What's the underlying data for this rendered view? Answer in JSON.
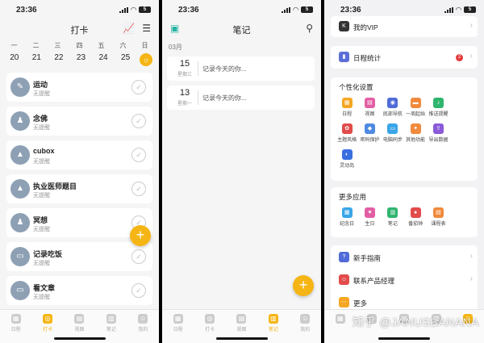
{
  "status": {
    "time": "23:36",
    "battery": "5"
  },
  "checkin": {
    "title": "打卡",
    "weekdays": [
      "日",
      "一",
      "二",
      "三",
      "四",
      "五",
      "六",
      "日"
    ],
    "dates": [
      "20",
      "21",
      "22",
      "23",
      "24",
      "25",
      "26"
    ],
    "items": [
      {
        "name": "运动",
        "sub": "无提醒"
      },
      {
        "name": "念佛",
        "sub": "无提醒"
      },
      {
        "name": "cubox",
        "sub": "无提醒"
      },
      {
        "name": "执业医师题目",
        "sub": "无提醒"
      },
      {
        "name": "冥想",
        "sub": "无提醒"
      },
      {
        "name": "记录吃饭",
        "sub": "无提醒"
      },
      {
        "name": "看文章",
        "sub": "无提醒"
      }
    ],
    "fab": "+"
  },
  "tabs": [
    "日程",
    "打卡",
    "视图",
    "笔记",
    "我的"
  ],
  "notes": {
    "title": "笔记",
    "month": "03月",
    "items": [
      {
        "day": "15",
        "weekday": "星期三",
        "text": "记录今天的你..."
      },
      {
        "day": "13",
        "weekday": "星期一",
        "text": "记录今天的你..."
      }
    ]
  },
  "me": {
    "vip": "我的VIP",
    "stats": "日程统计",
    "stats_badge": "2",
    "personal_title": "个性化设置",
    "personal": [
      "日程",
      "视图",
      "底部导航",
      "一周起始",
      "推送提醒",
      "主题风格",
      "密码保护",
      "电脑同步",
      "其他功能",
      "导出数据",
      "灵动岛"
    ],
    "apps_title": "更多应用",
    "apps": [
      "纪念日",
      "生日",
      "笔记",
      "番茄钟",
      "课程表"
    ],
    "guide": "新手指南",
    "contact": "联系产品经理",
    "more": "更多"
  },
  "watermark": "知乎 @JANUSBANANA",
  "colors": {
    "accent": "#f5b514",
    "icon_gray": "#8ea0b4",
    "badge": "#e23b3b"
  }
}
